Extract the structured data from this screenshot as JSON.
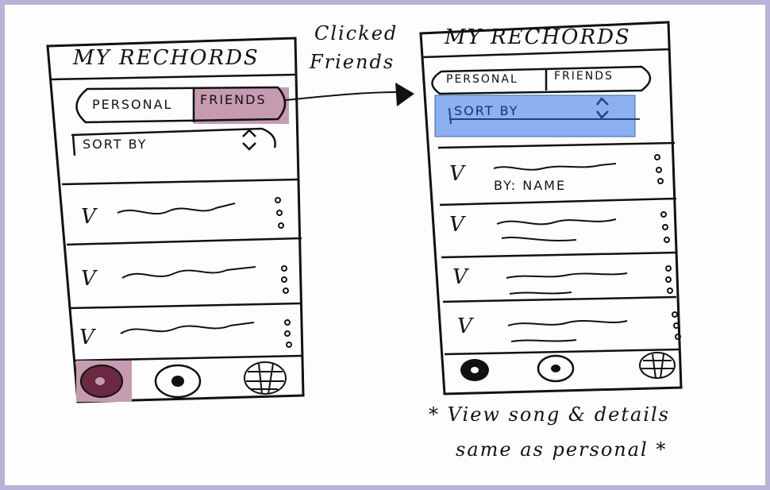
{
  "annotations": {
    "clicked_line1": "Clicked",
    "clicked_line2": "Friends",
    "note_line1": "* View song & details",
    "note_line2": "same as personal *"
  },
  "left_phone": {
    "title": "MY RECHORDS",
    "tabs": [
      "PERSONAL",
      "FRIENDS"
    ],
    "sort_label": "SORT BY",
    "rows": [
      "V",
      "V",
      "V"
    ],
    "selected_tab": "FRIENDS",
    "highlight_color": "#c69bb0"
  },
  "right_phone": {
    "title": "MY RECHORDS",
    "tabs": [
      "PERSONAL",
      "FRIENDS"
    ],
    "sort_label": "SORT BY",
    "first_row_label": "BY: NAME",
    "rows": [
      "V",
      "V",
      "V",
      "V"
    ],
    "highlight_color": "#8db0f0"
  }
}
